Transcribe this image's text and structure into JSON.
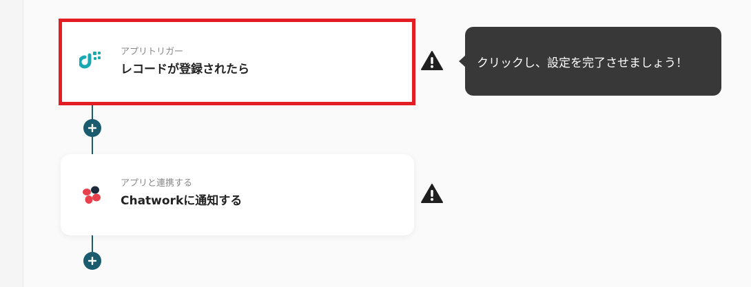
{
  "flow": {
    "steps": [
      {
        "type_label": "アプリトリガー",
        "title": "レコードが登録されたら",
        "app_icon": "kintone-like-icon",
        "status_icon": "warning-icon"
      },
      {
        "type_label": "アプリと連携する",
        "title": "Chatworkに通知する",
        "app_icon": "chatwork-icon",
        "status_icon": "warning-icon"
      }
    ],
    "add_step_icon": "plus-icon"
  },
  "tooltip": {
    "text": "クリックし、設定を完了させましょう！"
  },
  "colors": {
    "connector": "#1a5b6e",
    "selected_border": "#e21e24",
    "tooltip_bg": "#383838",
    "trigger_icon": "#18a9b3",
    "chatwork_red": "#e8404c",
    "chatwork_dark": "#1c2a3a"
  }
}
